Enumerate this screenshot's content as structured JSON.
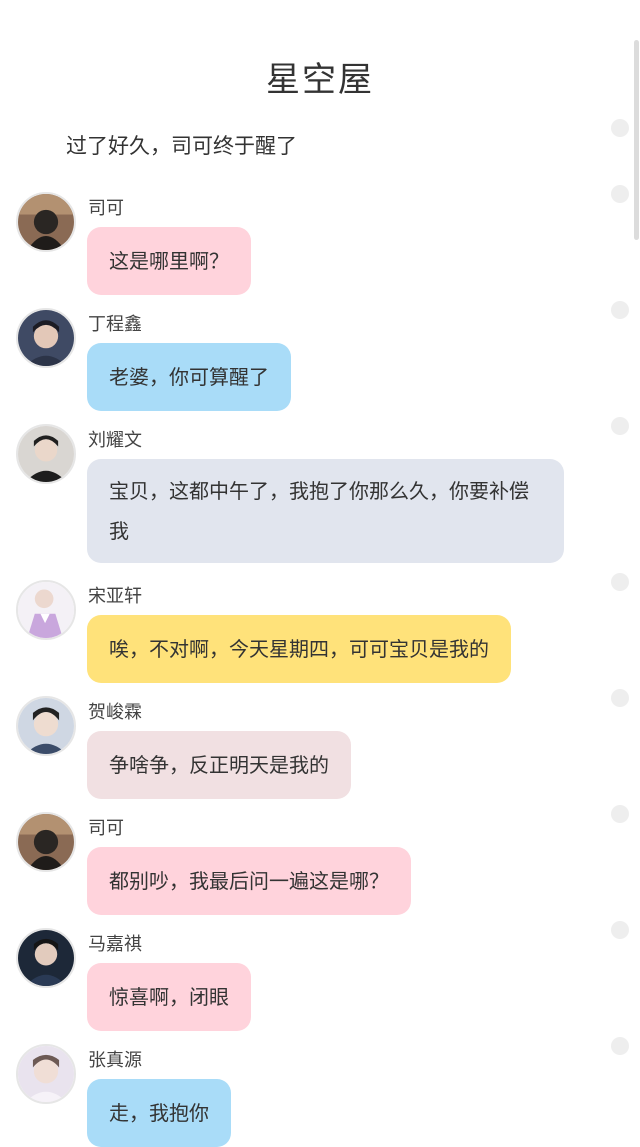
{
  "header": {
    "title": "星空屋"
  },
  "narration": "过了好久，司可终于醒了",
  "messages": [
    {
      "name": "司可",
      "text": "这是哪里啊？",
      "bubble_color": "#ffd3dc",
      "avatar": "sike"
    },
    {
      "name": "丁程鑫",
      "text": "老婆，你可算醒了",
      "bubble_color": "#a9dcf8",
      "avatar": "ding"
    },
    {
      "name": "刘耀文",
      "text": "宝贝，这都中午了，我抱了你那么久，你要补偿我",
      "bubble_color": "#e1e5ee",
      "avatar": "liu"
    },
    {
      "name": "宋亚轩",
      "text": "唉，不对啊，今天星期四，可可宝贝是我的",
      "bubble_color": "#ffe27a",
      "avatar": "song"
    },
    {
      "name": "贺峻霖",
      "text": "争啥争，反正明天是我的",
      "bubble_color": "#f1e0e2",
      "avatar": "he"
    },
    {
      "name": "司可",
      "text": "都别吵，我最后问一遍这是哪？",
      "bubble_color": "#ffd3dc",
      "avatar": "sike"
    },
    {
      "name": "马嘉祺",
      "text": "惊喜啊，闭眼",
      "bubble_color": "#ffd3dc",
      "avatar": "ma"
    },
    {
      "name": "张真源",
      "text": "走，我抱你",
      "bubble_color": "#a9dcf8",
      "avatar": "zhang"
    }
  ]
}
